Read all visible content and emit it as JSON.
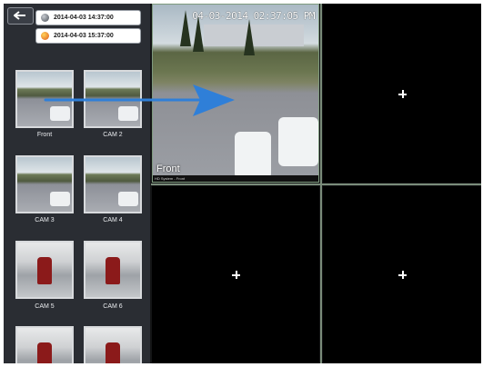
{
  "timeline": {
    "start": "2014-04-03 14:37:00",
    "end": "2014-04-03 15:37:00"
  },
  "cameras": [
    {
      "label": "Front",
      "scene": "lot"
    },
    {
      "label": "CAM 2",
      "scene": "lot"
    },
    {
      "label": "CAM 3",
      "scene": "lot"
    },
    {
      "label": "CAM 4",
      "scene": "lot"
    },
    {
      "label": "CAM 5",
      "scene": "office"
    },
    {
      "label": "CAM 6",
      "scene": "office"
    },
    {
      "label": "",
      "scene": "office"
    },
    {
      "label": "",
      "scene": "office"
    }
  ],
  "feed": {
    "osd_timestamp": "04-03-2014 02:37:05 PM",
    "camera_name": "Front",
    "subtitle": "HD System - Front"
  },
  "colors": {
    "arrow": "#2f7fd8",
    "sidebar": "#2a2d33",
    "grid_divider": "#7a8c7a"
  },
  "icons": {
    "back": "back-arrow-icon",
    "add": "plus-icon"
  }
}
